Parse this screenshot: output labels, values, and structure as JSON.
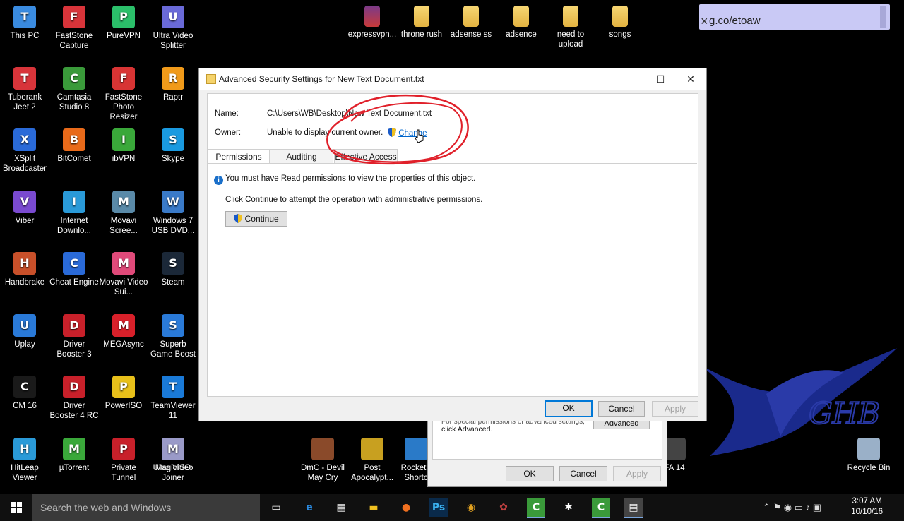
{
  "desktop_icons": [
    {
      "label": "This PC",
      "icon": "computer-icon",
      "color": "#3a8be0"
    },
    {
      "label": "FastStone Capture",
      "icon": "faststone-capture-icon",
      "color": "#d8343a"
    },
    {
      "label": "PureVPN",
      "icon": "purevpn-icon",
      "color": "#2bbf6a"
    },
    {
      "label": "Ultra Video Splitter",
      "icon": "video-splitter-icon",
      "color": "#6a6ad8"
    },
    {
      "label": "Tuberank Jeet 2",
      "icon": "tuberank-icon",
      "color": "#d8343a"
    },
    {
      "label": "Camtasia Studio 8",
      "icon": "camtasia-icon",
      "color": "#3a9a3a"
    },
    {
      "label": "FastStone Photo Resizer",
      "icon": "photo-resizer-icon",
      "color": "#d83434"
    },
    {
      "label": "Raptr",
      "icon": "raptr-icon",
      "color": "#f09a1a"
    },
    {
      "label": "XSplit Broadcaster",
      "icon": "xsplit-icon",
      "color": "#2a6ad8"
    },
    {
      "label": "BitComet",
      "icon": "bitcomet-icon",
      "color": "#e86a1a"
    },
    {
      "label": "ibVPN",
      "icon": "ibvpn-icon",
      "color": "#3aa83a"
    },
    {
      "label": "Skype",
      "icon": "skype-icon",
      "color": "#1a9ae0"
    },
    {
      "label": "Viber",
      "icon": "viber-icon",
      "color": "#7a4ad0"
    },
    {
      "label": "Internet Downlo...",
      "icon": "idm-icon",
      "color": "#2a9ad8"
    },
    {
      "label": "Movavi Scree...",
      "icon": "movavi-screen-icon",
      "color": "#5a8aa8"
    },
    {
      "label": "Windows 7 USB DVD...",
      "icon": "windows-usb-icon",
      "color": "#3a7ac8"
    },
    {
      "label": "Handbrake",
      "icon": "handbrake-icon",
      "color": "#c8502a"
    },
    {
      "label": "Cheat Engine",
      "icon": "cheat-engine-icon",
      "color": "#2a6ad8"
    },
    {
      "label": "Movavi Video Sui...",
      "icon": "movavi-suite-icon",
      "color": "#e04a7a"
    },
    {
      "label": "Steam",
      "icon": "steam-icon",
      "color": "#1b2838"
    },
    {
      "label": "Uplay",
      "icon": "uplay-icon",
      "color": "#2a7ad8"
    },
    {
      "label": "Driver Booster 3",
      "icon": "driver-booster-icon",
      "color": "#c8202a"
    },
    {
      "label": "MEGAsync",
      "icon": "megasync-icon",
      "color": "#d8202a"
    },
    {
      "label": "Superb Game Boost",
      "icon": "game-boost-icon",
      "color": "#2a7ad8"
    },
    {
      "label": "CM 16",
      "icon": "cm16-icon",
      "color": "#1a1a1a"
    },
    {
      "label": "Driver Booster 4 RC",
      "icon": "driver-booster-rc-icon",
      "color": "#c8202a"
    },
    {
      "label": "PowerISO",
      "icon": "poweriso-icon",
      "color": "#e8c01a"
    },
    {
      "label": "TeamViewer 11",
      "icon": "teamviewer-icon",
      "color": "#1a7ad8"
    },
    {
      "label": "HitLeap Viewer",
      "icon": "hitleap-icon",
      "color": "#2a9ad8"
    },
    {
      "label": "µTorrent",
      "icon": "utorrent-icon",
      "color": "#3aa83a"
    },
    {
      "label": "Private Tunnel",
      "icon": "private-tunnel-icon",
      "color": "#c8202a"
    },
    {
      "label": "Ultra Video Joiner",
      "icon": "video-joiner-icon",
      "color": "#4a8a4a"
    },
    {
      "label": "MagicISO",
      "icon": "magiciso-icon",
      "color": "#9a9ac8"
    }
  ],
  "top_files": [
    {
      "label": "expressvpn...",
      "icon": "archive-icon"
    },
    {
      "label": "throne rush",
      "icon": "folder-icon"
    },
    {
      "label": "adsense ss",
      "icon": "folder-icon"
    },
    {
      "label": "adsence",
      "icon": "folder-icon"
    },
    {
      "label": "need to upload",
      "icon": "folder-icon"
    },
    {
      "label": "songs",
      "icon": "folder-icon"
    }
  ],
  "bottom_icons": [
    {
      "label": "DmC - Devil May Cry",
      "icon": "dmc-icon"
    },
    {
      "label": "Post Apocalypt...",
      "icon": "pam-icon"
    },
    {
      "label": "Rocket - Shortc",
      "icon": "rocket-icon"
    },
    {
      "label": "FA 14",
      "icon": "fa14-icon"
    },
    {
      "label": "Recycle Bin",
      "icon": "recycle-bin-icon"
    }
  ],
  "url_overlay": {
    "text": "g.co/etoaw",
    "close": "×"
  },
  "watermark": "GHB",
  "dialog": {
    "title": "Advanced Security Settings for New Text Document.txt",
    "minimize": "—",
    "maximize": "☐",
    "close": "✕",
    "name_label": "Name:",
    "name_value": "C:\\Users\\WB\\Desktop\\New Text Document.txt",
    "owner_label": "Owner:",
    "owner_value": "Unable to display current owner.",
    "change_link": "Change",
    "tabs": [
      "Permissions",
      "Auditing",
      "Effective Access"
    ],
    "info_message": "You must have Read permissions to view the properties of this object.",
    "continue_message": "Click Continue to attempt the operation with administrative permissions.",
    "continue_button": "Continue",
    "ok": "OK",
    "cancel": "Cancel",
    "apply": "Apply"
  },
  "back_dialog": {
    "text_line1": "For special permissions or advanced settings,",
    "text_line2": "click Advanced.",
    "advanced": "Advanced",
    "ok": "OK",
    "cancel": "Cancel",
    "apply": "Apply"
  },
  "taskbar": {
    "search_placeholder": "Search the web and Windows",
    "time": "3:07 AM",
    "date": "10/10/16"
  },
  "colors": {
    "annotation": "#e0202a",
    "link": "#0066cc",
    "accent": "#0078d7"
  }
}
